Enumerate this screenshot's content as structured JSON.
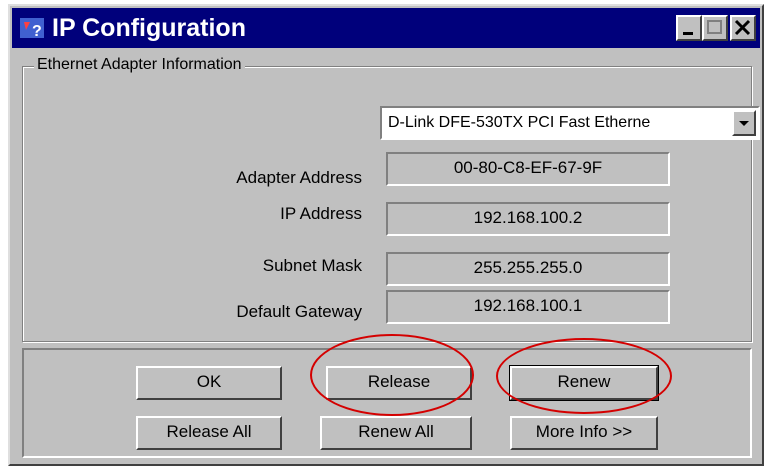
{
  "window": {
    "title": "IP Configuration"
  },
  "group": {
    "label": "Ethernet  Adapter Information"
  },
  "adapter_select": {
    "value": "D-Link DFE-530TX PCI Fast Etherne"
  },
  "fields": [
    {
      "label": "Adapter Address",
      "value": "00-80-C8-EF-67-9F"
    },
    {
      "label": "IP Address",
      "value": "192.168.100.2"
    },
    {
      "label": "Subnet Mask",
      "value": "255.255.255.0"
    },
    {
      "label": "Default Gateway",
      "value": "192.168.100.1"
    }
  ],
  "buttons": {
    "ok": "OK",
    "release": "Release",
    "renew": "Renew",
    "release_all": "Release All",
    "renew_all": "Renew All",
    "more_info": "More Info >>"
  },
  "colors": {
    "titlebar": "#00007b",
    "highlight_circle": "#d40000",
    "face": "#c0c0c0"
  },
  "icons": [
    "network-config-icon",
    "minimize-icon",
    "maximize-icon",
    "close-icon",
    "dropdown-arrow-icon"
  ]
}
